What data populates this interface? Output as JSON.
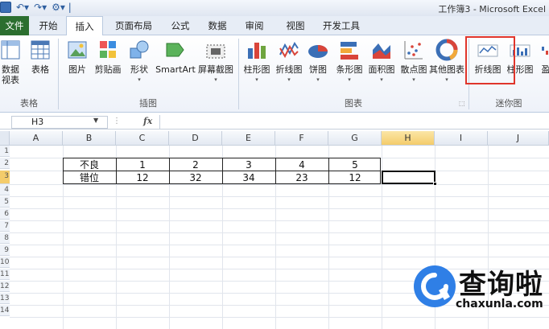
{
  "window": {
    "title": "工作簿3 - Microsoft Excel"
  },
  "tabs": [
    "文件",
    "开始",
    "插入",
    "页面布局",
    "公式",
    "数据",
    "审阅",
    "视图",
    "开发工具"
  ],
  "active_tab": "插入",
  "ribbon": {
    "buttons": [
      {
        "label": "数据\n视表",
        "icon": "pivot-table-icon"
      },
      {
        "label": "表格",
        "icon": "table-icon"
      },
      {
        "label": "图片",
        "icon": "picture-icon"
      },
      {
        "label": "剪贴画",
        "icon": "clip-art-icon"
      },
      {
        "label": "形状",
        "icon": "shapes-icon"
      },
      {
        "label": "SmartArt",
        "icon": "smartart-icon"
      },
      {
        "label": "屏幕截图",
        "icon": "screenshot-icon"
      },
      {
        "label": "柱形图",
        "icon": "column-chart-icon"
      },
      {
        "label": "折线图",
        "icon": "line-chart-icon"
      },
      {
        "label": "饼图",
        "icon": "pie-chart-icon"
      },
      {
        "label": "条形图",
        "icon": "bar-chart-icon"
      },
      {
        "label": "面积图",
        "icon": "area-chart-icon"
      },
      {
        "label": "散点图",
        "icon": "scatter-chart-icon"
      },
      {
        "label": "其他图表",
        "icon": "other-charts-icon"
      },
      {
        "label": "折线图",
        "icon": "sparkline-line-icon"
      },
      {
        "label": "柱形图",
        "icon": "sparkline-column-icon"
      },
      {
        "label": "盈",
        "icon": "sparkline-winloss-icon"
      }
    ],
    "groups": [
      "表格",
      "插图",
      "图表",
      "迷你图"
    ]
  },
  "formula_bar": {
    "name_box": "H3",
    "fx": "fx",
    "formula": ""
  },
  "columns": [
    "A",
    "B",
    "C",
    "D",
    "E",
    "F",
    "G",
    "H",
    "I",
    "J"
  ],
  "selected_column": "H",
  "rows": [
    "1",
    "2",
    "3",
    "4",
    "5",
    "6",
    "7",
    "8",
    "9",
    "10",
    "11",
    "12",
    "13",
    "14"
  ],
  "selected_row": "3",
  "table": {
    "row1": [
      "不良",
      "1",
      "2",
      "3",
      "4",
      "5"
    ],
    "row2": [
      "错位",
      "12",
      "32",
      "34",
      "23",
      "12"
    ]
  },
  "watermark": {
    "title": "查询啦",
    "url": "chaxunla.com",
    "accent": "#2f7fe6",
    "dark": "#111111"
  }
}
